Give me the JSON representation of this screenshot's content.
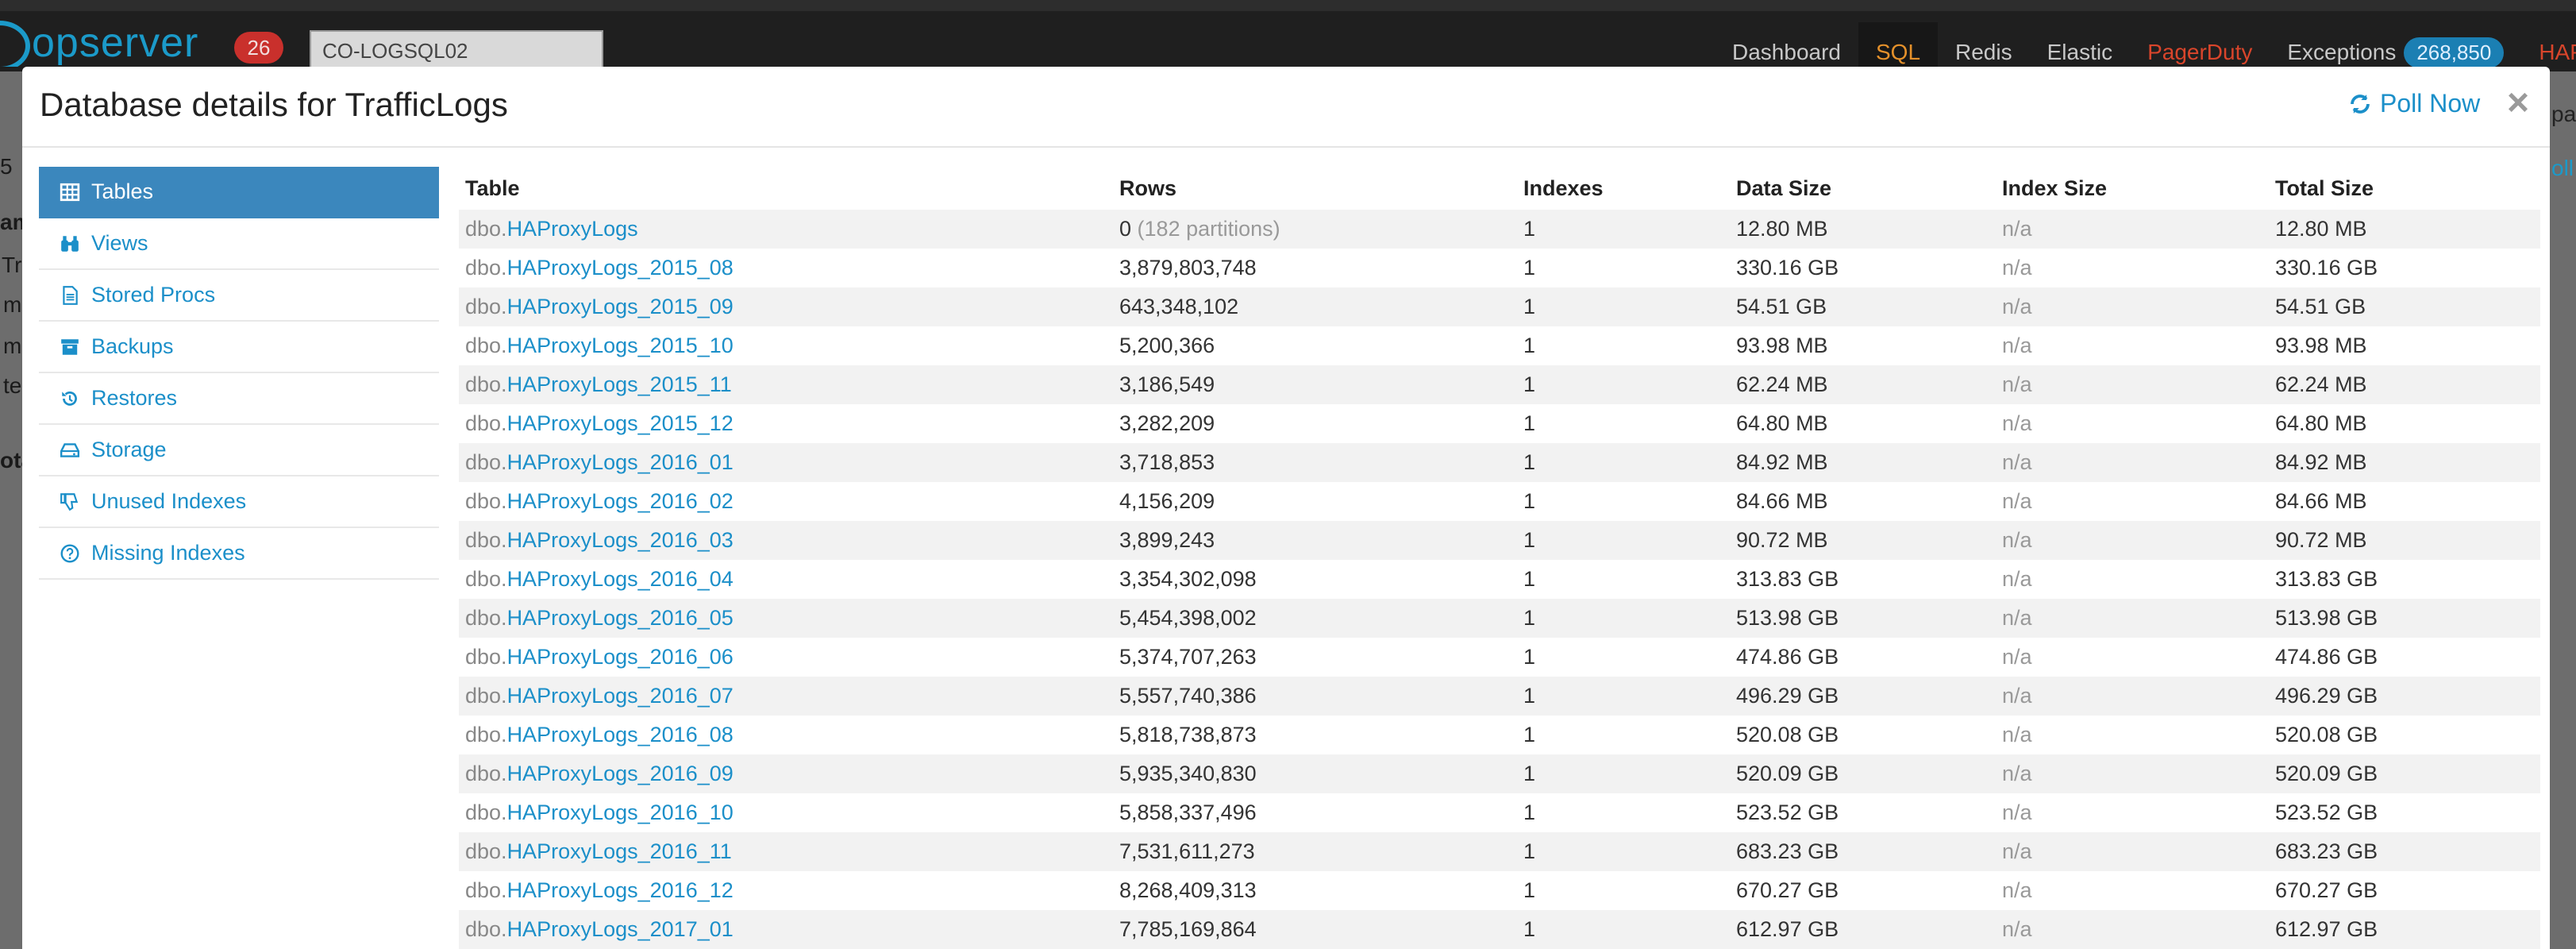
{
  "navbar": {
    "brand": "opserver",
    "badge_count": "26",
    "server_value": "CO-LOGSQL02",
    "items": [
      {
        "label": "Dashboard",
        "state": "normal"
      },
      {
        "label": "SQL",
        "state": "active"
      },
      {
        "label": "Redis",
        "state": "normal"
      },
      {
        "label": "Elastic",
        "state": "normal"
      },
      {
        "label": "PagerDuty",
        "state": "pager"
      },
      {
        "label": "Exceptions",
        "state": "normal",
        "count": "268,850"
      },
      {
        "label": "HAP",
        "state": "hap"
      }
    ]
  },
  "background": {
    "left_fragments": [
      "5",
      "am",
      "Tr",
      "m",
      "m",
      "te",
      "ota"
    ],
    "right_fragments": [
      "pa",
      "oll"
    ]
  },
  "modal": {
    "title": "Database details for TrafficLogs",
    "poll_label": "Poll Now",
    "close_label": "×"
  },
  "sidebar": {
    "items": [
      {
        "label": "Tables",
        "icon": "table-icon",
        "active": true
      },
      {
        "label": "Views",
        "icon": "binoculars-icon",
        "active": false
      },
      {
        "label": "Stored Procs",
        "icon": "file-icon",
        "active": false
      },
      {
        "label": "Backups",
        "icon": "archive-icon",
        "active": false
      },
      {
        "label": "Restores",
        "icon": "history-icon",
        "active": false
      },
      {
        "label": "Storage",
        "icon": "hdd-icon",
        "active": false
      },
      {
        "label": "Unused Indexes",
        "icon": "thumbs-down-icon",
        "active": false
      },
      {
        "label": "Missing Indexes",
        "icon": "question-circle-icon",
        "active": false
      }
    ]
  },
  "table": {
    "columns": [
      "Table",
      "Rows",
      "Indexes",
      "Data Size",
      "Index Size",
      "Total Size"
    ],
    "rows": [
      {
        "schema": "dbo.",
        "name": "HAProxyLogs",
        "rows": "0",
        "rows_note": "(182 partitions)",
        "indexes": "1",
        "data_size": "12.80 MB",
        "index_size": "n/a",
        "total_size": "12.80 MB"
      },
      {
        "schema": "dbo.",
        "name": "HAProxyLogs_2015_08",
        "rows": "3,879,803,748",
        "rows_note": "",
        "indexes": "1",
        "data_size": "330.16 GB",
        "index_size": "n/a",
        "total_size": "330.16 GB"
      },
      {
        "schema": "dbo.",
        "name": "HAProxyLogs_2015_09",
        "rows": "643,348,102",
        "rows_note": "",
        "indexes": "1",
        "data_size": "54.51 GB",
        "index_size": "n/a",
        "total_size": "54.51 GB"
      },
      {
        "schema": "dbo.",
        "name": "HAProxyLogs_2015_10",
        "rows": "5,200,366",
        "rows_note": "",
        "indexes": "1",
        "data_size": "93.98 MB",
        "index_size": "n/a",
        "total_size": "93.98 MB"
      },
      {
        "schema": "dbo.",
        "name": "HAProxyLogs_2015_11",
        "rows": "3,186,549",
        "rows_note": "",
        "indexes": "1",
        "data_size": "62.24 MB",
        "index_size": "n/a",
        "total_size": "62.24 MB"
      },
      {
        "schema": "dbo.",
        "name": "HAProxyLogs_2015_12",
        "rows": "3,282,209",
        "rows_note": "",
        "indexes": "1",
        "data_size": "64.80 MB",
        "index_size": "n/a",
        "total_size": "64.80 MB"
      },
      {
        "schema": "dbo.",
        "name": "HAProxyLogs_2016_01",
        "rows": "3,718,853",
        "rows_note": "",
        "indexes": "1",
        "data_size": "84.92 MB",
        "index_size": "n/a",
        "total_size": "84.92 MB"
      },
      {
        "schema": "dbo.",
        "name": "HAProxyLogs_2016_02",
        "rows": "4,156,209",
        "rows_note": "",
        "indexes": "1",
        "data_size": "84.66 MB",
        "index_size": "n/a",
        "total_size": "84.66 MB"
      },
      {
        "schema": "dbo.",
        "name": "HAProxyLogs_2016_03",
        "rows": "3,899,243",
        "rows_note": "",
        "indexes": "1",
        "data_size": "90.72 MB",
        "index_size": "n/a",
        "total_size": "90.72 MB"
      },
      {
        "schema": "dbo.",
        "name": "HAProxyLogs_2016_04",
        "rows": "3,354,302,098",
        "rows_note": "",
        "indexes": "1",
        "data_size": "313.83 GB",
        "index_size": "n/a",
        "total_size": "313.83 GB"
      },
      {
        "schema": "dbo.",
        "name": "HAProxyLogs_2016_05",
        "rows": "5,454,398,002",
        "rows_note": "",
        "indexes": "1",
        "data_size": "513.98 GB",
        "index_size": "n/a",
        "total_size": "513.98 GB"
      },
      {
        "schema": "dbo.",
        "name": "HAProxyLogs_2016_06",
        "rows": "5,374,707,263",
        "rows_note": "",
        "indexes": "1",
        "data_size": "474.86 GB",
        "index_size": "n/a",
        "total_size": "474.86 GB"
      },
      {
        "schema": "dbo.",
        "name": "HAProxyLogs_2016_07",
        "rows": "5,557,740,386",
        "rows_note": "",
        "indexes": "1",
        "data_size": "496.29 GB",
        "index_size": "n/a",
        "total_size": "496.29 GB"
      },
      {
        "schema": "dbo.",
        "name": "HAProxyLogs_2016_08",
        "rows": "5,818,738,873",
        "rows_note": "",
        "indexes": "1",
        "data_size": "520.08 GB",
        "index_size": "n/a",
        "total_size": "520.08 GB"
      },
      {
        "schema": "dbo.",
        "name": "HAProxyLogs_2016_09",
        "rows": "5,935,340,830",
        "rows_note": "",
        "indexes": "1",
        "data_size": "520.09 GB",
        "index_size": "n/a",
        "total_size": "520.09 GB"
      },
      {
        "schema": "dbo.",
        "name": "HAProxyLogs_2016_10",
        "rows": "5,858,337,496",
        "rows_note": "",
        "indexes": "1",
        "data_size": "523.52 GB",
        "index_size": "n/a",
        "total_size": "523.52 GB"
      },
      {
        "schema": "dbo.",
        "name": "HAProxyLogs_2016_11",
        "rows": "7,531,611,273",
        "rows_note": "",
        "indexes": "1",
        "data_size": "683.23 GB",
        "index_size": "n/a",
        "total_size": "683.23 GB"
      },
      {
        "schema": "dbo.",
        "name": "HAProxyLogs_2016_12",
        "rows": "8,268,409,313",
        "rows_note": "",
        "indexes": "1",
        "data_size": "670.27 GB",
        "index_size": "n/a",
        "total_size": "670.27 GB"
      },
      {
        "schema": "dbo.",
        "name": "HAProxyLogs_2017_01",
        "rows": "7,785,169,864",
        "rows_note": "",
        "indexes": "1",
        "data_size": "612.97 GB",
        "index_size": "n/a",
        "total_size": "612.97 GB"
      }
    ]
  }
}
